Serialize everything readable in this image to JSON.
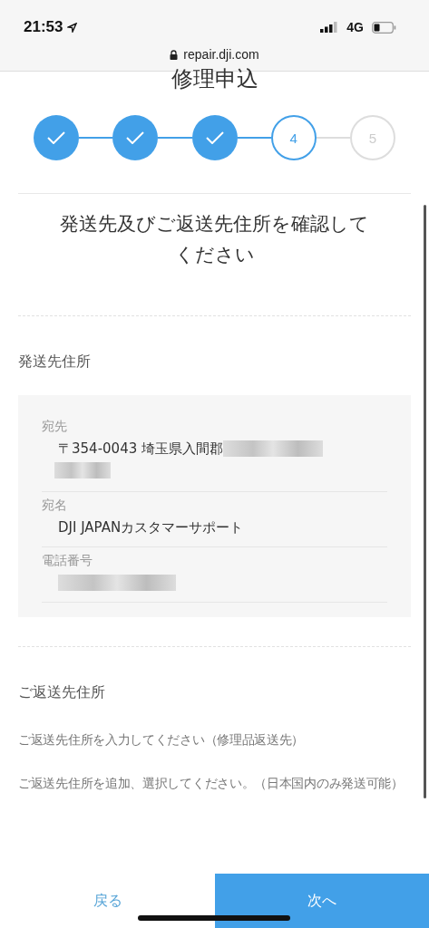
{
  "status_bar": {
    "time": "21:53",
    "network": "4G"
  },
  "url_bar": {
    "url": "repair.dji.com"
  },
  "title": "修理申込",
  "steps": [
    {
      "kind": "done"
    },
    {
      "kind": "done"
    },
    {
      "kind": "done"
    },
    {
      "kind": "current",
      "label": "4"
    },
    {
      "kind": "pending",
      "label": "5"
    }
  ],
  "heading": "発送先及びご返送先住所を確認してください",
  "shipping": {
    "title": "発送先住所",
    "fields": [
      {
        "label": "宛先",
        "value": "〒354-0043 埼玉県入間郡",
        "redacted": true
      },
      {
        "label": "宛名",
        "value": "DJI JAPANカスタマーサポート",
        "redacted": false
      },
      {
        "label": "電話番号",
        "redacted": true
      }
    ]
  },
  "return": {
    "title": "ご返送先住所",
    "notes": [
      "ご返送先住所を入力してください（修理品返送先）",
      "ご返送先住所を追加、選択してください。（日本国内のみ発送可能）"
    ]
  },
  "footer": {
    "back": "戻る",
    "next": "次へ"
  }
}
